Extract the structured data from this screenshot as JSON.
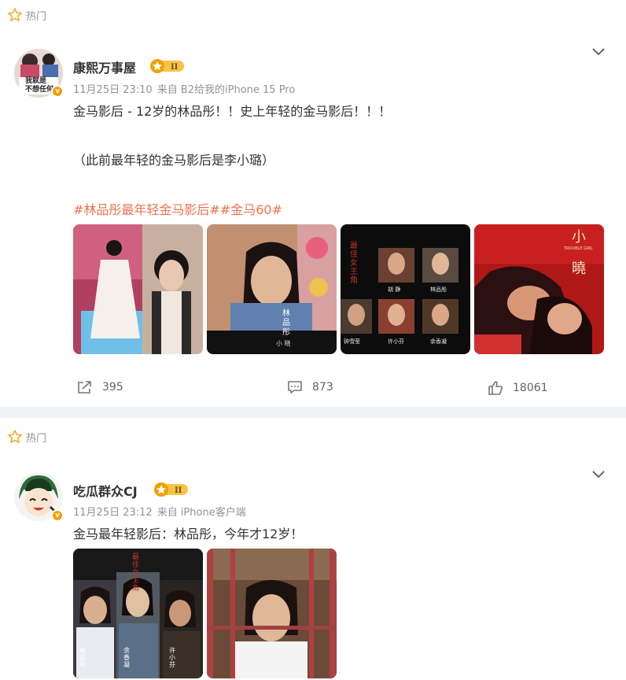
{
  "posts": [
    {
      "hot_label": "热门",
      "author": "康熙万事屋",
      "time": "11月25日 23:10",
      "source": "来自 B2给我的iPhone 15 Pro",
      "text_line1": "金马影后 - 12岁的林品彤！！史上年轻的金马影后！！！",
      "text_line2": "（此前最年轻的金马影后是李小璐）",
      "hashtags": "#林品彤最年轻金马影后##金马60#",
      "images": [
        {
          "caption": ""
        },
        {
          "caption": "林品彤",
          "subcaption": "小 晓"
        },
        {
          "caption": "最佳女主角",
          "names": [
            "胡 静",
            "林品彤",
            "钟雪莹",
            "许小芬",
            "余香凝"
          ]
        },
        {
          "caption": "小",
          "caption2": "曉",
          "subcaption": "TROUBLE GIRL"
        }
      ],
      "actions": {
        "repost": "395",
        "comment": "873",
        "like": "18061"
      }
    },
    {
      "hot_label": "热门",
      "author": "吃瓜群众CJ",
      "time": "11月25日 23:12",
      "source": "来自 iPhone客户端",
      "text_line1": "金马最年轻影后：林品彤，今年才12岁！",
      "images": [
        {
          "caption": "最佳女主角",
          "names": [
            "林品彤",
            "余香凝",
            "许小芬"
          ]
        },
        {
          "caption": ""
        }
      ]
    }
  ],
  "avatar1_text": [
    "我就是",
    "不想任何"
  ],
  "colors": {
    "hashtag": "#eb7350",
    "meta": "#939393",
    "badge": "#f0a000"
  }
}
